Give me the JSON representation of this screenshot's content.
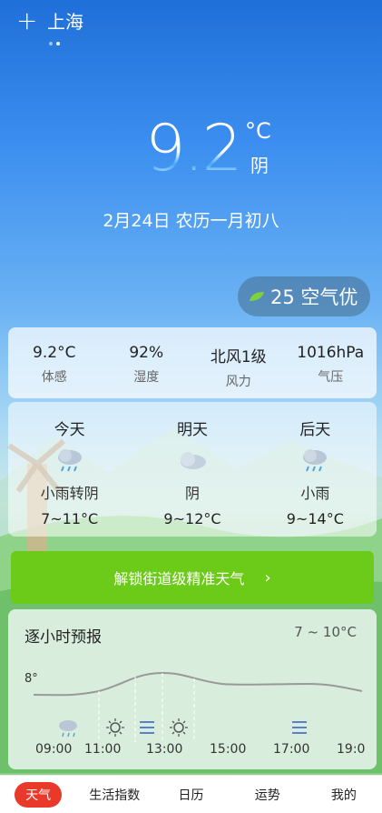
{
  "header": {
    "add_icon": "plus-icon",
    "city": "上海"
  },
  "current": {
    "temp": "9.2",
    "unit": "°C",
    "condition": "阴",
    "date": "2月24日 农历一月初八"
  },
  "aqi": {
    "icon": "leaf-icon",
    "text": "25 空气优",
    "color": "#7fd13b"
  },
  "stats": [
    {
      "value": "9.2°C",
      "label": "体感"
    },
    {
      "value": "92%",
      "label": "湿度"
    },
    {
      "value": "北风1级",
      "label": "风力"
    },
    {
      "value": "1016hPa",
      "label": "气压"
    }
  ],
  "forecast": [
    {
      "day": "今天",
      "icon": "rain-cloud-icon",
      "cond": "小雨转阴",
      "range": "7~11°C"
    },
    {
      "day": "明天",
      "icon": "cloud-icon",
      "cond": "阴",
      "range": "9~12°C"
    },
    {
      "day": "后天",
      "icon": "rain-cloud-icon",
      "cond": "小雨",
      "range": "9~14°C"
    }
  ],
  "unlock": {
    "label": "解锁街道级精准天气",
    "chevron": "›",
    "color": "#6ccb18"
  },
  "hourly": {
    "title": "逐小时预报",
    "range": "7 ~ 10°C",
    "start_label": "8°",
    "times": [
      "09:00",
      "11:00",
      "13:00",
      "15:00",
      "17:00",
      "19:0"
    ]
  },
  "tabs": [
    {
      "label": "天气",
      "active": true
    },
    {
      "label": "生活指数"
    },
    {
      "label": "日历"
    },
    {
      "label": "运势"
    },
    {
      "label": "我的"
    }
  ],
  "colors": {
    "accent_red": "#e8392a",
    "green": "#6ccb18"
  }
}
